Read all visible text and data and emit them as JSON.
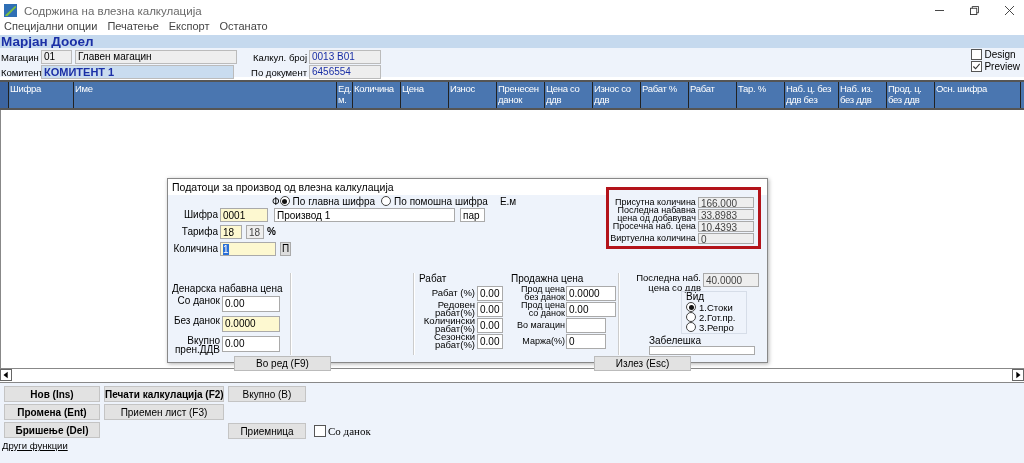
{
  "window": {
    "title": "Содржина на влезна калкулација"
  },
  "menu": [
    "Специјални опции",
    "Печатење",
    "Експорт",
    "Останато"
  ],
  "company": "Марјан Дооел",
  "header": {
    "warehouse": {
      "label": "Магацин",
      "code": "01",
      "name": "Главен магацин"
    },
    "client": {
      "label": "Комитент",
      "value": "КОМИТЕНТ 1"
    },
    "calc_no": {
      "label": "Калкул. број",
      "value": "0013   B01"
    },
    "document": {
      "label": "По документ",
      "value": "6456554"
    }
  },
  "options": [
    {
      "label": "Design",
      "checked": false
    },
    {
      "label": "Preview",
      "checked": true
    }
  ],
  "table": {
    "columns": [
      "Шифра",
      "Име",
      "Ед. м.",
      "Количина",
      "Цена",
      "Износ",
      "Пренесен данок",
      "Цена со ддв",
      "Износ со ддв",
      "Рабат %",
      "Рабат",
      "Тар. %",
      "Наб. ц. без ддв без",
      "Наб. из. без ддв",
      "Прод. ц. без ддв",
      "Осн. шифра"
    ]
  },
  "dialog": {
    "title": "Податоци за производ од влезна калкулација",
    "search_label": "Ф",
    "search_mode": [
      {
        "label": "По главна шифра",
        "selected": true
      },
      {
        "label": "По помошна шифра",
        "selected": false
      }
    ],
    "unit_label": "Е.м",
    "code": {
      "label": "Шифра",
      "value": "0001"
    },
    "name": "Производ 1",
    "unit": "пар",
    "tariff": {
      "label": "Тарифа",
      "value": "18",
      "rate": "18",
      "unit": "%"
    },
    "quantity": {
      "label": "Количина",
      "value": "1",
      "button": "П"
    },
    "stock": [
      {
        "label": "Присутна количина",
        "value": "166.000"
      },
      {
        "label": "Последна набавна цена од добавувач",
        "value": "33.8983"
      },
      {
        "label": "Просечна наб. цена",
        "value": "10.4393"
      },
      {
        "label": "Виртуелна количина",
        "value": "0"
      }
    ],
    "purchase": {
      "title": "Денарска набавна цена",
      "fields": [
        {
          "label": "Со данок",
          "value": "0.00",
          "highlighted": false
        },
        {
          "label": "Без данок",
          "value": "0.0000",
          "highlighted": true
        },
        {
          "label": "Вкупно прен.ДДВ",
          "value": "0.00",
          "highlighted": false
        }
      ]
    },
    "discount": {
      "title": "Рабат",
      "fields": [
        {
          "label": "Рабат (%)",
          "value": "0.00"
        },
        {
          "label": "Редовен рабат(%)",
          "value": "0.00"
        },
        {
          "label": "Количински рабат(%)",
          "value": "0.00"
        },
        {
          "label": "Сезонски рабат(%)",
          "value": "0.00"
        }
      ]
    },
    "sale": {
      "title": "Продажна цена",
      "fields": [
        {
          "label": "Прод цена без данок",
          "value": "0.0000"
        },
        {
          "label": "Прод цена со данок",
          "value": "0.00"
        },
        {
          "label": "Во магацин"
        },
        {
          "label": "Маржа(%)",
          "value": "0"
        }
      ]
    },
    "last_price": {
      "label": "Последна наб. цена со ддв",
      "value": "40.0000"
    },
    "type": {
      "label": "Вид",
      "options": [
        {
          "label": "1.Стоки",
          "selected": true
        },
        {
          "label": "2.Гот.пр.",
          "selected": false
        },
        {
          "label": "3.Репро",
          "selected": false
        }
      ]
    },
    "note": {
      "label": "Забелешка"
    },
    "buttons": [
      "Во ред (F9)",
      "Излез (Esc)"
    ]
  },
  "actions": [
    [
      {
        "label": "Нов (Ins)",
        "bold": true
      },
      {
        "label": "Промена (Ent)",
        "bold": true
      },
      {
        "label": "Бришење (Del)",
        "bold": true
      }
    ],
    [
      {
        "label": "Печати калкулација (F2)",
        "bold": true
      },
      {
        "label": "Приемен лист (F3)",
        "bold": false
      }
    ],
    [
      {
        "label": "Вкупно (B)",
        "bold": false
      },
      {
        "label": "Приемница",
        "bold": false
      }
    ]
  ],
  "tax_checkbox": {
    "label": "Со данок",
    "checked": false
  },
  "link": "Други функции"
}
